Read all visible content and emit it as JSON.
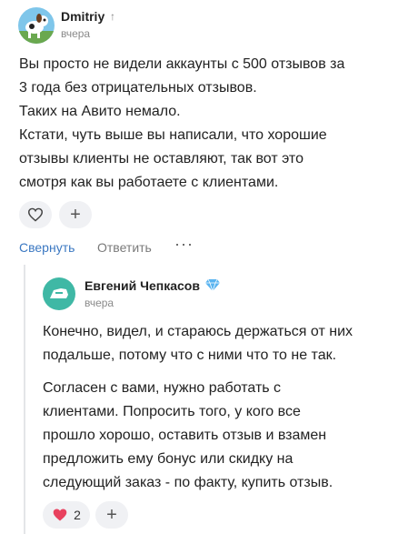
{
  "comment": {
    "author": "Dmitriy",
    "date": "вчера",
    "lines": [
      "Вы просто не видели аккаунты с 500 отзывов за",
      "3 года без отрицательных отзывов.",
      "Таких на Авито немало.",
      "Кстати, чуть выше вы написали, что хорошие",
      "отзывы клиенты не оставляют, так вот это",
      "смотря как вы работаете с клиентами."
    ],
    "collapse_label": "Свернуть",
    "reply_label": "Ответить",
    "more_label": "···"
  },
  "reply": {
    "author": "Евгений Чепкасов",
    "date": "вчера",
    "paragraphs": [
      [
        "Конечно, видел, и стараюсь держаться от них",
        "подальше, потому что с ними что то не так."
      ],
      [
        "Согласен с вами, нужно работать с",
        "клиентами. Попросить того, у кого все",
        "прошло хорошо, оставить отзыв и взамен",
        "предложить ему бонус или скидку на",
        "следующий заказ - по факту, купить отзыв."
      ]
    ],
    "like_count": "2"
  },
  "icons": {
    "upvote": "arrow-up-icon",
    "verified": "diamond-icon",
    "like": "heart-icon",
    "add": "plus-icon"
  },
  "colors": {
    "link": "#3b78c2",
    "heart": "#e8415e",
    "diamond": "#5ab4f0",
    "avatar2": "#3fb8a5"
  }
}
